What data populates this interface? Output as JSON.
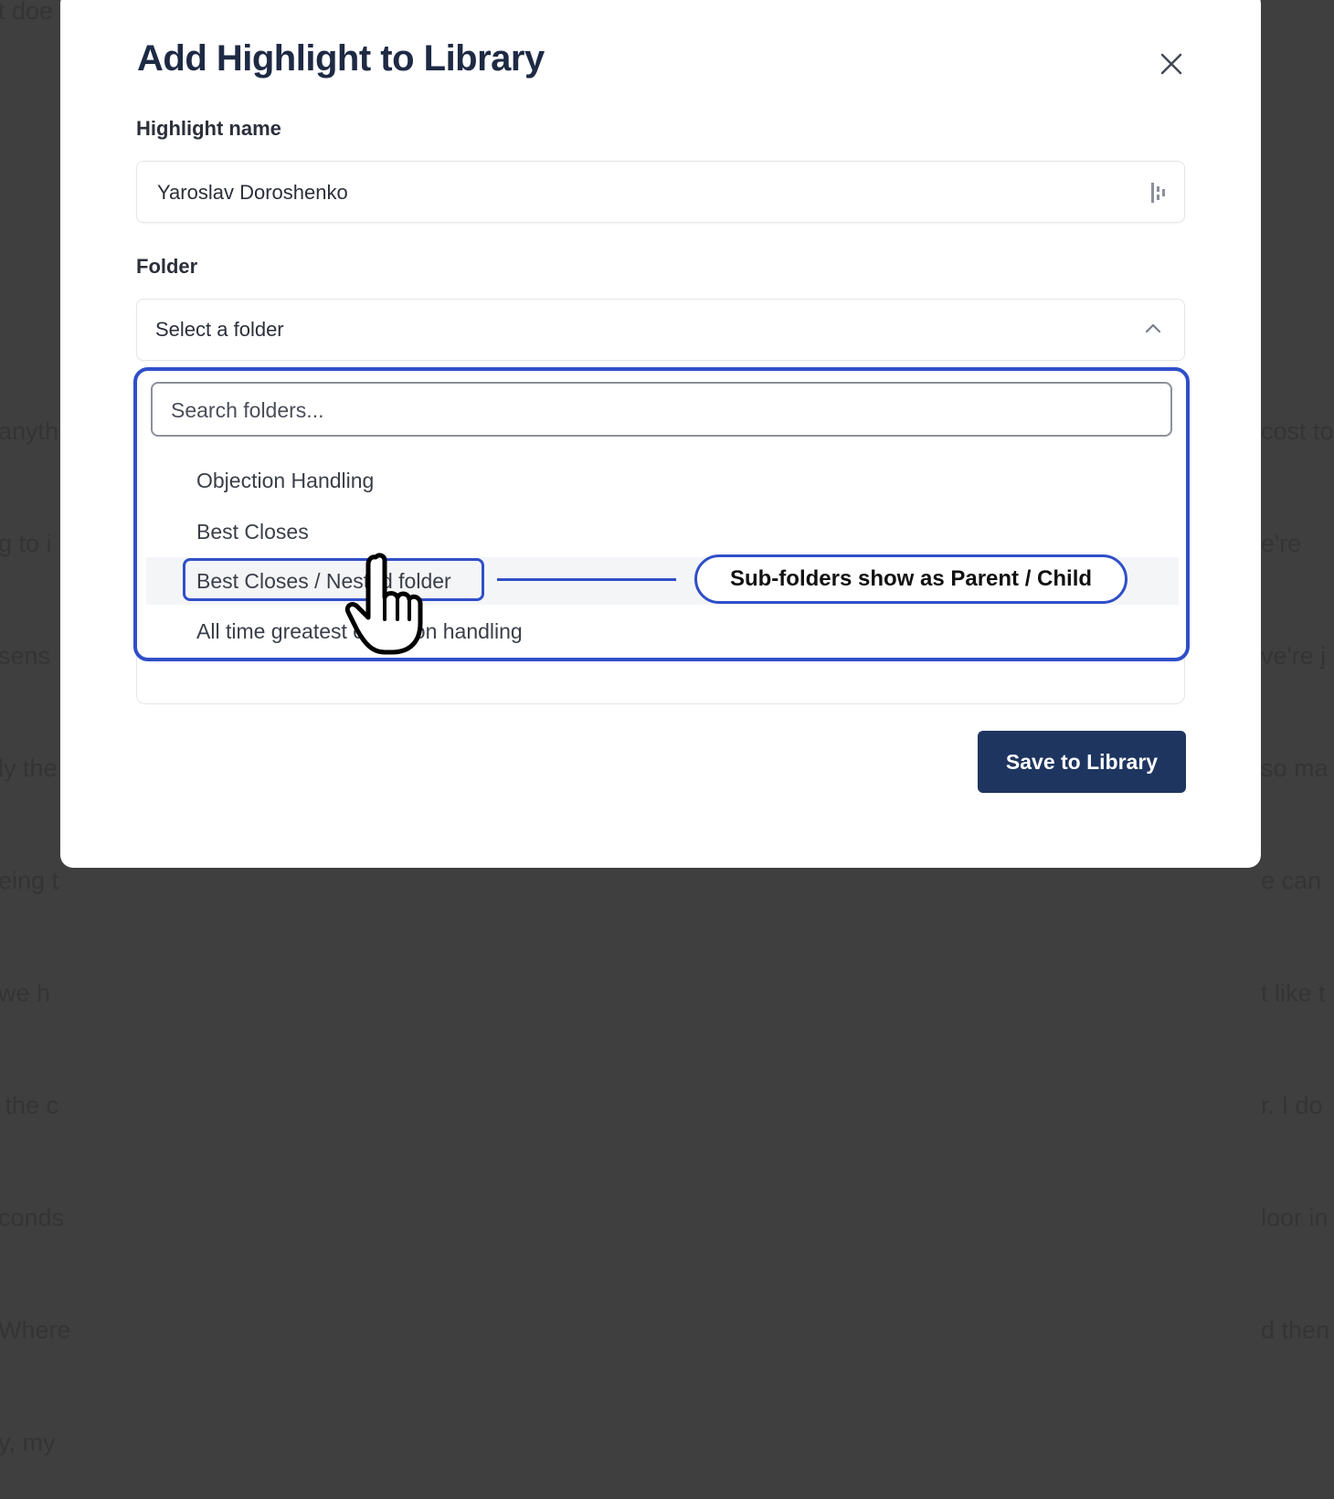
{
  "background": {
    "left_top_fragment": "t doe",
    "left_lines": [
      "anyth",
      "g to i",
      "sens",
      "ly the",
      "eing t",
      "we h",
      " the c",
      "conds",
      "Where",
      "y, my"
    ],
    "right_lines": [
      "cost to",
      "e're",
      "ve're j",
      "so ma",
      "e can",
      "t like t",
      "r. I do",
      "loor in",
      "d then"
    ]
  },
  "modal": {
    "title": "Add Highlight to Library",
    "close_label": "×",
    "highlight_name_label": "Highlight name",
    "highlight_name_value": "Yaroslav Doroshenko",
    "folder_label": "Folder",
    "folder_placeholder": "Select a folder",
    "save_label": "Save to Library"
  },
  "dropdown": {
    "search_placeholder": "Search folders...",
    "options": [
      "Objection Handling",
      "Best Closes",
      "Best Closes / Nested folder",
      "All time greatest objection handling"
    ],
    "hovered_index": 2
  },
  "annotation": {
    "callout_text": "Sub-folders show as Parent / Child",
    "color": "#2f4fc8"
  },
  "colors": {
    "accent": "#1e3560",
    "annotation": "#2f4fc8",
    "title": "#1e2a44"
  }
}
